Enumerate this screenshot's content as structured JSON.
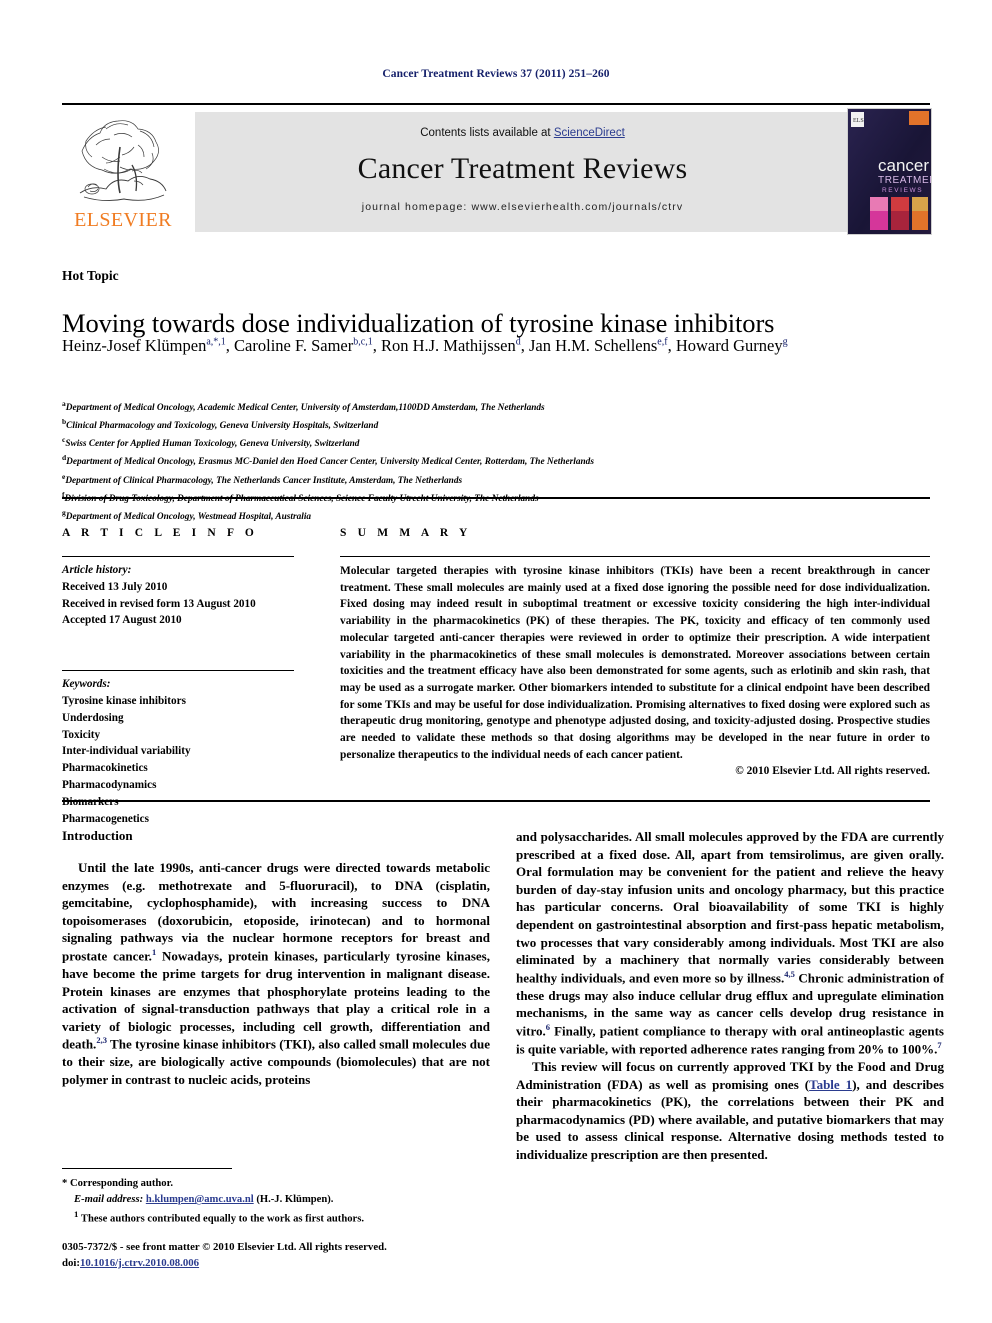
{
  "running_head": "Cancer Treatment Reviews 37 (2011) 251–260",
  "masthead": {
    "contents_prefix": "Contents lists available at ",
    "sciencedirect": "ScienceDirect",
    "journal_title": "Cancer Treatment Reviews",
    "homepage": "journal homepage: www.elsevierhealth.com/journals/ctrv",
    "publisher_name": "ELSEVIER",
    "publisher_color": "#f07c22",
    "link_color": "#2b3c8f",
    "box_color": "#e3e3e3",
    "cover": {
      "line1": "cancer",
      "line2": "TREATMENT",
      "line3": "REVIEWS",
      "background": "#1a1733"
    }
  },
  "article": {
    "section_label": "Hot Topic",
    "title": "Moving towards dose individualization of tyrosine kinase inhibitors",
    "authors": [
      {
        "name": "Heinz-Josef Klümpen",
        "sup": "a,*,1",
        "sep": ", "
      },
      {
        "name": "Caroline F. Samer",
        "sup": "b,c,1",
        "sep": ", "
      },
      {
        "name": "Ron H.J. Mathijssen",
        "sup": "d",
        "sep": ", "
      },
      {
        "name": "Jan H.M. Schellens",
        "sup": "e,f",
        "sep": ", "
      },
      {
        "name": "Howard Gurney",
        "sup": "g",
        "sep": ""
      }
    ],
    "affiliations": [
      {
        "mark": "a",
        "text": "Department of Medical Oncology, Academic Medical Center, University of Amsterdam,1100DD Amsterdam, The Netherlands"
      },
      {
        "mark": "b",
        "text": "Clinical Pharmacology and Toxicology, Geneva University Hospitals, Switzerland"
      },
      {
        "mark": "c",
        "text": "Swiss Center for Applied Human Toxicology, Geneva University, Switzerland"
      },
      {
        "mark": "d",
        "text": "Department of Medical Oncology, Erasmus MC-Daniel den Hoed Cancer Center, University Medical Center, Rotterdam, The Netherlands"
      },
      {
        "mark": "e",
        "text": "Department of Clinical Pharmacology, The Netherlands Cancer Institute, Amsterdam, The Netherlands"
      },
      {
        "mark": "f",
        "text": "Division of Drug Toxicology, Department of Pharmaceutical Sciences, Science Faculty Utrecht University, The Netherlands"
      },
      {
        "mark": "g",
        "text": "Department of Medical Oncology, Westmead Hospital, Australia"
      }
    ]
  },
  "article_info": {
    "heading": "A R T I C L E   I N F O",
    "history_label": "Article history:",
    "history": [
      "Received 13 July 2010",
      "Received in revised form 13 August 2010",
      "Accepted 17 August 2010"
    ],
    "keywords_label": "Keywords:",
    "keywords": [
      "Tyrosine kinase inhibitors",
      "Underdosing",
      "Toxicity",
      "Inter-individual variability",
      "Pharmacokinetics",
      "Pharmacodynamics",
      "Biomarkers",
      "Pharmacogenetics"
    ]
  },
  "summary": {
    "heading": "S U M M A R Y",
    "text": "Molecular targeted therapies with tyrosine kinase inhibitors (TKIs) have been a recent breakthrough in cancer treatment. These small molecules are mainly used at a fixed dose ignoring the possible need for dose individualization. Fixed dosing may indeed result in suboptimal treatment or excessive toxicity considering the high inter-individual variability in the pharmacokinetics (PK) of these therapies. The PK, toxicity and efficacy of ten commonly used molecular targeted anti-cancer therapies were reviewed in order to optimize their prescription. A wide interpatient variability in the pharmacokinetics of these small molecules is demonstrated. Moreover associations between certain toxicities and the treatment efficacy have also been demonstrated for some agents, such as erlotinib and skin rash, that may be used as a surrogate marker. Other biomarkers intended to substitute for a clinical endpoint have been described for some TKIs and may be useful for dose individualization. Promising alternatives to fixed dosing were explored such as therapeutic drug monitoring, genotype and phenotype adjusted dosing, and toxicity-adjusted dosing. Prospective studies are needed to validate these methods so that dosing algorithms may be developed in the near future in order to personalize therapeutics to the individual needs of each cancer patient.",
    "copyright": "© 2010 Elsevier Ltd. All rights reserved."
  },
  "body": {
    "intro_heading": "Introduction",
    "left_para_1_a": "Until the late 1990s, anti-cancer drugs were directed towards metabolic enzymes (e.g. methotrexate and 5-fluoruracil), to DNA (cisplatin, gemcitabine, cyclophosphamide), with increasing success to DNA topoisomerases (doxorubicin, etoposide, irinotecan) and to hormonal signaling pathways via the nuclear hormone receptors for breast and prostate cancer.",
    "left_ref_1": "1",
    "left_para_1_b": " Nowadays, protein kinases, particularly tyrosine kinases, have become the prime targets for drug intervention in malignant disease. Protein kinases are enzymes that phosphorylate proteins leading to the activation of signal-transduction pathways that play a critical role in a variety of biologic processes, including cell growth, differentiation and death.",
    "left_ref_2": "2,3",
    "left_para_1_c": " The tyrosine kinase inhibitors (TKI), also called small molecules due to their size, are biologically active compounds (biomolecules) that are not polymer in contrast to nucleic acids, proteins",
    "right_para_1_a": "and polysaccharides. All small molecules approved by the FDA are currently prescribed at a fixed dose. All, apart from temsirolimus, are given orally. Oral formulation may be convenient for the patient and relieve the heavy burden of day-stay infusion units and oncology pharmacy, but this practice has particular concerns. Oral bioavailability of some TKI is highly dependent on gastrointestinal absorption and first-pass hepatic metabolism, two processes that vary considerably among individuals. Most TKI are also eliminated by a machinery that normally varies considerably between healthy individuals, and even more so by illness.",
    "right_ref_1": "4,5",
    "right_para_1_b": " Chronic administration of these drugs may also induce cellular drug efflux and upregulate elimination mechanisms, in the same way as cancer cells develop drug resistance in vitro.",
    "right_ref_2": "6",
    "right_para_1_c": " Finally, patient compliance to therapy with oral antineoplastic agents is quite variable, with reported adherence rates ranging from 20% to 100%.",
    "right_ref_3": "7",
    "right_para_2_a": "This review will focus on currently approved TKI by the Food and Drug Administration (FDA) as well as promising ones (",
    "right_table_link": "Table 1",
    "right_para_2_b": "), and describes their pharmacokinetics (PK), the correlations between their PK and pharmacodynamics (PD) where available, and putative biomarkers that may be used to assess clinical response. Alternative dosing methods tested to individualize prescription are then presented."
  },
  "footnotes": {
    "corresponding": "* Corresponding author.",
    "email_label": "E-mail address:",
    "email": "h.klumpen@amc.uva.nl",
    "email_suffix": " (H.-J. Klümpen).",
    "equal_mark": "1",
    "equal_text": "These authors contributed equally to the work as first authors.",
    "issn_line": "0305-7372/$ - see front matter © 2010 Elsevier Ltd. All rights reserved.",
    "doi_label": "doi:",
    "doi": "10.1016/j.ctrv.2010.08.006"
  }
}
